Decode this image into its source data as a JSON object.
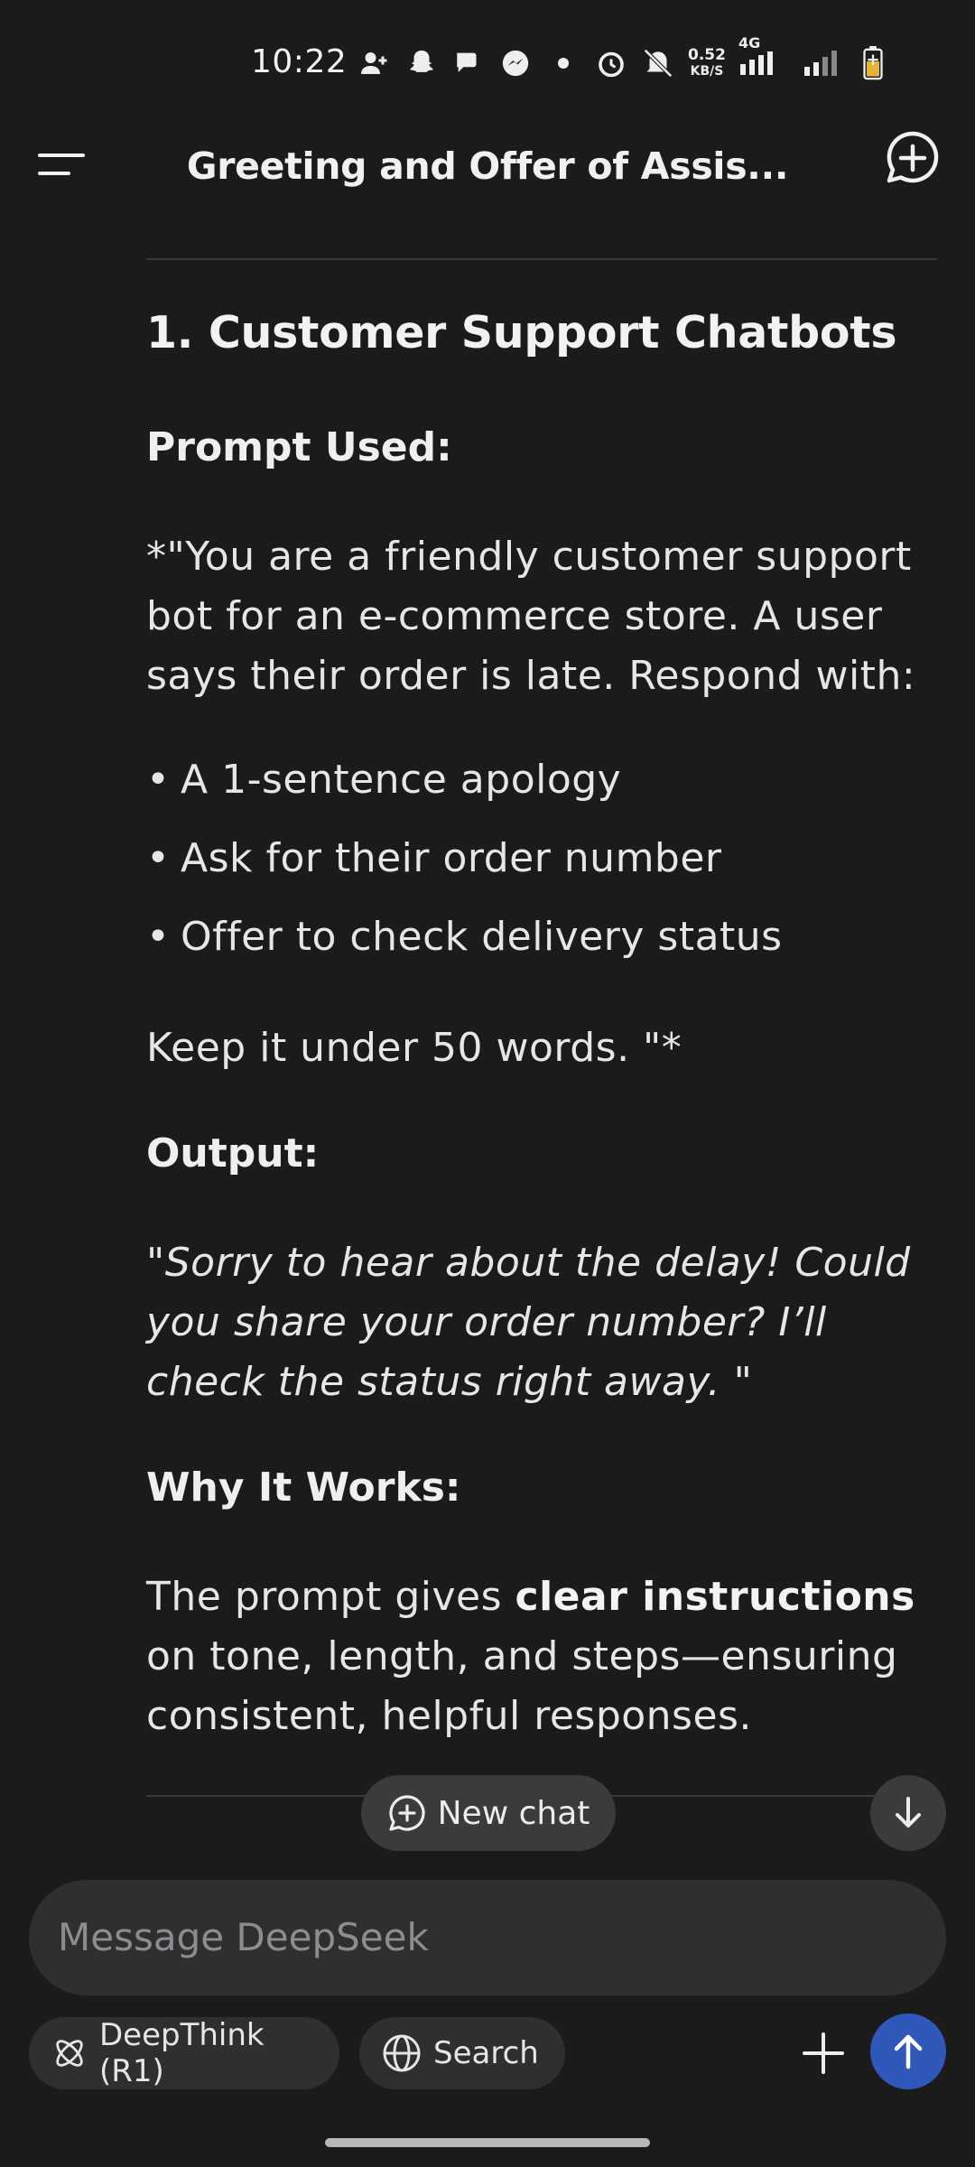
{
  "status_bar": {
    "time": "10:22",
    "speed_value": "0.52",
    "speed_unit": "KB/S",
    "network": "4G"
  },
  "header": {
    "title": "Greeting and Offer of Assis..."
  },
  "content": {
    "section_heading": "1.  Customer Support Chatbots",
    "prompt_used_label": "Prompt Used:",
    "prompt_line1": "*\"You are a friendly customer support",
    "prompt_line2": "bot for an e-commerce store.  A user",
    "prompt_line3": "says their order is late.  Respond with:",
    "bullets": [
      "A 1-sentence apology",
      "Ask for their order number",
      "Offer to check delivery status"
    ],
    "keep_line": "Keep it under 50 words. \"*",
    "output_label": "Output:",
    "output_line1": "\"Sorry to hear about the delay!  Could",
    "output_line2": "you share your order number?  I’ll",
    "output_line3": "check the status right away. \"",
    "why_label": "Why It Works:",
    "why_line1_pre": "The prompt gives ",
    "why_line1_bold": "clear instructions",
    "why_line2": "on tone,  length,  and steps—ensuring",
    "why_line3": "consistent,  helpful responses."
  },
  "floating": {
    "new_chat_label": "New chat"
  },
  "composer": {
    "placeholder": "Message DeepSeek",
    "deepthink_label": "DeepThink (R1)",
    "search_label": "Search"
  },
  "colors": {
    "background": "#1b1b1c",
    "send_button": "#2f58b8",
    "pill": "#3b3b3d"
  }
}
